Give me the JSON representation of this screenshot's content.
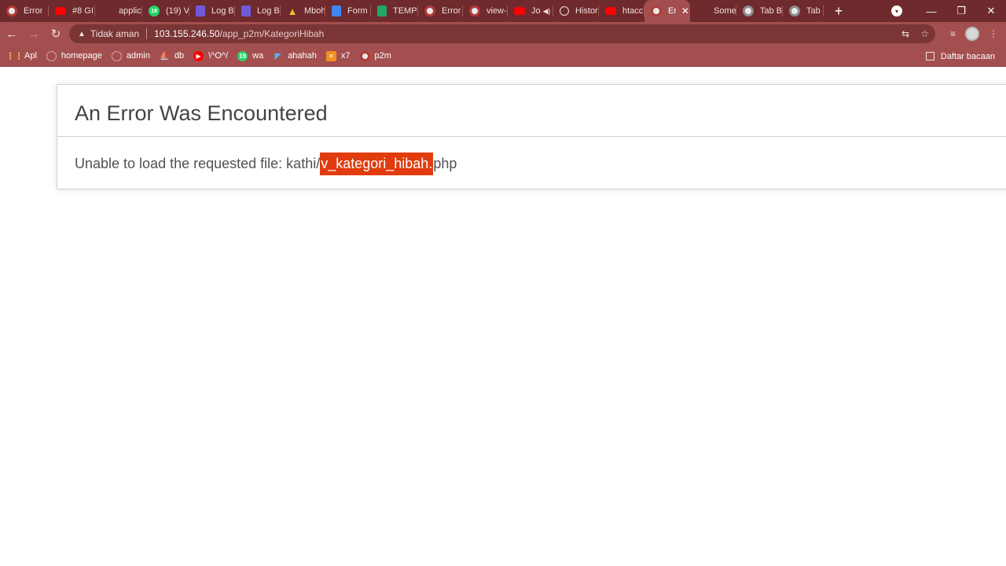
{
  "browser": {
    "tabs": [
      {
        "label": "Error",
        "icon": "chrome-icon",
        "icon_class": "ico-chrome",
        "width": 62
      },
      {
        "label": "#8 GI",
        "icon": "youtube-icon",
        "icon_class": "ico-yt",
        "width": 59
      },
      {
        "label": "applic",
        "icon": "gitlab-icon",
        "icon_class": "ico-gitlab",
        "width": 60
      },
      {
        "label": "(19) V",
        "icon": "whatsapp-icon",
        "icon_class": "ico-wa",
        "glyph": "19",
        "width": 60
      },
      {
        "label": "Log B",
        "icon": "forms-icon",
        "icon_class": "ico-docs-purple",
        "width": 58
      },
      {
        "label": "Log B",
        "icon": "forms-icon",
        "icon_class": "ico-docs-purple",
        "width": 58
      },
      {
        "label": "Mboh",
        "icon": "drive-icon",
        "icon_class": "ico-drive",
        "glyph": "▲",
        "width": 57
      },
      {
        "label": "Form",
        "icon": "docs-icon",
        "icon_class": "ico-docs-blue",
        "width": 58
      },
      {
        "label": "TEMP",
        "icon": "sheets-icon",
        "icon_class": "ico-sheets",
        "width": 60
      },
      {
        "label": "Error",
        "icon": "chrome-icon",
        "icon_class": "ico-chrome",
        "width": 57
      },
      {
        "label": "view-",
        "icon": "chrome-icon",
        "icon_class": "ico-chrome",
        "width": 57
      },
      {
        "label": "Jo",
        "icon": "youtube-icon",
        "icon_class": "ico-yt",
        "audio": "◀)",
        "width": 58
      },
      {
        "label": "Histor",
        "icon": "history-icon",
        "icon_class": "ico-history",
        "width": 58
      },
      {
        "label": "htacc",
        "icon": "youtube-icon",
        "icon_class": "ico-yt",
        "width": 58
      },
      {
        "label": "Er",
        "icon": "chrome-icon",
        "icon_class": "ico-chrome",
        "active": true,
        "close": "✕",
        "width": 58
      },
      {
        "label": "Some",
        "icon": "gitlab-icon",
        "icon_class": "ico-gitlab",
        "width": 59
      },
      {
        "label": "Tab B",
        "icon": "generic-icon",
        "icon_class": "ico-generic",
        "width": 59
      },
      {
        "label": "Tab B",
        "icon": "generic-icon",
        "icon_class": "ico-generic",
        "width": 52
      }
    ],
    "new_tab": "+",
    "tab_search": "▾",
    "window": {
      "minimize": "—",
      "restore": "❐",
      "close": "✕"
    },
    "nav": {
      "back": "←",
      "forward": "→",
      "reload": "↻"
    },
    "omnibox": {
      "security_icon": "▲",
      "security_label": "Tidak aman",
      "host": "103.155.246.50",
      "path": "/app_p2m/KategoriHibah",
      "translate_icon": "⇆",
      "star_icon": "☆"
    },
    "toolbar_right": {
      "media_icon": "≡"
    },
    "bookmarks": [
      {
        "label": "Apl",
        "icon": "apps-grid-icon",
        "icon_class": "bm-apps",
        "glyph": "⋮⋮"
      },
      {
        "label": "homepage",
        "icon": "globe-icon",
        "icon_class": "bm-globe",
        "glyph": ""
      },
      {
        "label": "admin",
        "icon": "globe-icon",
        "icon_class": "bm-globe",
        "glyph": ""
      },
      {
        "label": "db",
        "icon": "phpmyadmin-icon",
        "icon_class": "bm-db",
        "glyph": "⛵"
      },
      {
        "label": "\\^O^/",
        "icon": "youtube-icon",
        "icon_class": "ico-yt",
        "glyph": "▶"
      },
      {
        "label": "wa",
        "icon": "whatsapp-icon",
        "icon_class": "ico-wa",
        "glyph": "19"
      },
      {
        "label": "ahahah",
        "icon": "flutter-icon",
        "icon_class": "bm-flutter",
        "glyph": "◤"
      },
      {
        "label": "x7",
        "icon": "xampp-icon",
        "icon_class": "bm-x7",
        "glyph": "✕"
      },
      {
        "label": "p2m",
        "icon": "chrome-icon",
        "icon_class": "ico-chrome",
        "glyph": ""
      }
    ],
    "reading_list": "Daftar bacaan"
  },
  "page": {
    "title": "An Error Was Encountered",
    "message_prefix": "Unable to load the requested file: kathi/",
    "message_highlight": "v_kategori_hibah.",
    "message_suffix": "php"
  },
  "colors": {
    "tabstrip": "#6e2a2c",
    "toolbar": "#a44f4f",
    "highlight": "#e03c0e"
  }
}
